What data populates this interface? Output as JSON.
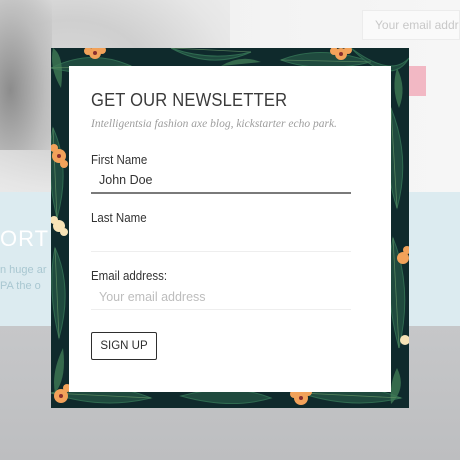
{
  "background": {
    "search_placeholder": "Your email address",
    "section_heading": "ORT",
    "text_lines": [
      "n huge ar",
      "PA the o"
    ]
  },
  "modal": {
    "title": "GET OUR NEWSLETTER",
    "subtitle": "Intelligentsia fashion axe blog, kickstarter echo park.",
    "fields": {
      "first_name": {
        "label": "First Name",
        "value": "John Doe"
      },
      "last_name": {
        "label": "Last Name",
        "value": ""
      },
      "email": {
        "label": "Email address:",
        "placeholder": "Your email address"
      }
    },
    "submit_label": "SIGN UP"
  },
  "colors": {
    "frame": "#0f2a2c",
    "leaf_dark": "#1f4a3e",
    "leaf_light": "#3f7a55",
    "flower": "#f2a25a",
    "accent_pink": "#f2b8c4"
  }
}
